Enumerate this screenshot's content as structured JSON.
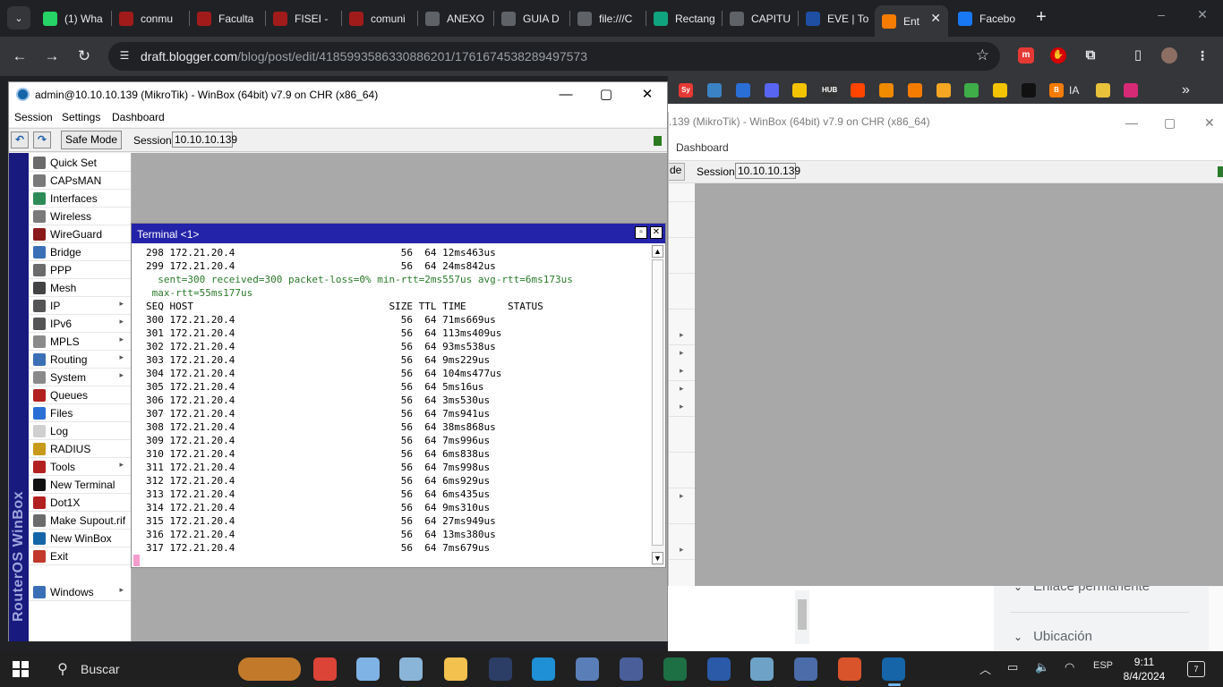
{
  "browser": {
    "tabs": [
      {
        "title": "(1) Wha",
        "icon": "whatsapp-icon",
        "color": "#25d366"
      },
      {
        "title": "conmu",
        "icon": "shield-red-icon",
        "color": "#a11b1b"
      },
      {
        "title": "Faculta",
        "icon": "shield-red-icon",
        "color": "#a11b1b"
      },
      {
        "title": "FISEI -",
        "icon": "shield-red-icon",
        "color": "#a11b1b"
      },
      {
        "title": "comuni",
        "icon": "shield-red-icon",
        "color": "#a11b1b"
      },
      {
        "title": "ANEXO",
        "icon": "globe-icon",
        "color": "#5f6368"
      },
      {
        "title": "GUIA D",
        "icon": "globe-icon",
        "color": "#5f6368"
      },
      {
        "title": "file:///C",
        "icon": "globe-icon",
        "color": "#5f6368"
      },
      {
        "title": "Rectang",
        "icon": "openai-icon",
        "color": "#10a37f"
      },
      {
        "title": "CAPITU",
        "icon": "globe-icon",
        "color": "#5f6368"
      },
      {
        "title": "EVE | To",
        "icon": "eve-icon",
        "color": "#1e4fa3"
      },
      {
        "title": "Ent",
        "icon": "blogger-icon",
        "color": "#f57c00"
      },
      {
        "title": "Facebo",
        "icon": "facebook-icon",
        "color": "#1877f2"
      }
    ],
    "url_host": "draft.blogger.com",
    "url_path": "/blog/post/edit/4185993586330886201/1761674538289497573",
    "bookmarks": [
      {
        "label": "",
        "icon": "sy-icon",
        "color": "#e53935",
        "text": "Sy"
      },
      {
        "label": "",
        "icon": "cloud-icon",
        "color": "#3b82c4",
        "text": ""
      },
      {
        "label": "",
        "icon": "cap-icon",
        "color": "#2a6fd6",
        "text": ""
      },
      {
        "label": "",
        "icon": "discord-icon",
        "color": "#5865f2",
        "text": ""
      },
      {
        "label": "",
        "icon": "image-icon",
        "color": "#f5c400",
        "text": ""
      },
      {
        "label": "",
        "icon": "hub-icon",
        "color": "#333333",
        "text": "HUB"
      },
      {
        "label": "",
        "icon": "reddit-icon",
        "color": "#ff4500",
        "text": ""
      },
      {
        "label": "",
        "icon": "gear-orange-icon",
        "color": "#f08a00",
        "text": ""
      },
      {
        "label": "",
        "icon": "orange-c-icon",
        "color": "#f57c00",
        "text": ""
      },
      {
        "label": "",
        "icon": "infinity-icon",
        "color": "#f5a623",
        "text": ""
      },
      {
        "label": "",
        "icon": "kiwi-icon",
        "color": "#3fae49",
        "text": ""
      },
      {
        "label": "",
        "icon": "chart-icon",
        "color": "#f5c400",
        "text": ""
      },
      {
        "label": "",
        "icon": "notion-icon",
        "color": "#111111",
        "text": ""
      },
      {
        "label": "IA",
        "icon": "blogger-icon",
        "color": "#f57c00",
        "text": "B"
      },
      {
        "label": "",
        "icon": "eye-icon",
        "color": "#e8c23a",
        "text": ""
      },
      {
        "label": "",
        "icon": "instagram-icon",
        "color": "#d62976",
        "text": ""
      }
    ]
  },
  "winbox": {
    "title": "admin@10.10.10.139 (MikroTik) - WinBox (64bit) v7.9 on CHR (x86_64)",
    "menus": [
      "Session",
      "Settings",
      "Dashboard"
    ],
    "safe_mode": "Safe Mode",
    "session_label": "Session:",
    "session_value": "10.10.10.139",
    "vertical_label": "RouterOS WinBox",
    "menu_items": [
      {
        "label": "Quick Set",
        "icon": "quickset-icon",
        "color": "#6b6b6b",
        "sub": false
      },
      {
        "label": "CAPsMAN",
        "icon": "capsman-icon",
        "color": "#7a7a7a",
        "sub": false
      },
      {
        "label": "Interfaces",
        "icon": "interfaces-icon",
        "color": "#2e8b57",
        "sub": false
      },
      {
        "label": "Wireless",
        "icon": "wireless-icon",
        "color": "#7a7a7a",
        "sub": false
      },
      {
        "label": "WireGuard",
        "icon": "wireguard-icon",
        "color": "#8b1a1a",
        "sub": false
      },
      {
        "label": "Bridge",
        "icon": "bridge-icon",
        "color": "#3b6fb6",
        "sub": false
      },
      {
        "label": "PPP",
        "icon": "ppp-icon",
        "color": "#6b6b6b",
        "sub": false
      },
      {
        "label": "Mesh",
        "icon": "mesh-icon",
        "color": "#444444",
        "sub": false
      },
      {
        "label": "IP",
        "icon": "ip-icon",
        "color": "#555555",
        "sub": true
      },
      {
        "label": "IPv6",
        "icon": "ipv6-icon",
        "color": "#555555",
        "sub": true
      },
      {
        "label": "MPLS",
        "icon": "mpls-icon",
        "color": "#8a8a8a",
        "sub": true
      },
      {
        "label": "Routing",
        "icon": "routing-icon",
        "color": "#3b6fb6",
        "sub": true
      },
      {
        "label": "System",
        "icon": "system-icon",
        "color": "#8a8a8a",
        "sub": true
      },
      {
        "label": "Queues",
        "icon": "queues-icon",
        "color": "#b32020",
        "sub": false
      },
      {
        "label": "Files",
        "icon": "files-icon",
        "color": "#2a6fd6",
        "sub": false
      },
      {
        "label": "Log",
        "icon": "log-icon",
        "color": "#cfcfcf",
        "sub": false
      },
      {
        "label": "RADIUS",
        "icon": "radius-icon",
        "color": "#c89a1a",
        "sub": false
      },
      {
        "label": "Tools",
        "icon": "tools-icon",
        "color": "#b32020",
        "sub": true
      },
      {
        "label": "New Terminal",
        "icon": "terminal-icon",
        "color": "#111111",
        "sub": false
      },
      {
        "label": "Dot1X",
        "icon": "dot1x-icon",
        "color": "#b32020",
        "sub": false
      },
      {
        "label": "Make Supout.rif",
        "icon": "supout-icon",
        "color": "#6b6b6b",
        "sub": false
      },
      {
        "label": "New WinBox",
        "icon": "winbox-icon",
        "color": "#1565a8",
        "sub": false
      },
      {
        "label": "Exit",
        "icon": "exit-icon",
        "color": "#c0392b",
        "sub": false
      },
      {
        "label": "Windows",
        "icon": "windows-icon",
        "color": "#3b6fb6",
        "sub": true
      }
    ]
  },
  "winbox_back": {
    "title": ".139 (MikroTik) - WinBox (64bit) v7.9 on CHR (x86_64)",
    "menu": "Dashboard",
    "safe_mode": "de",
    "session_label": "Session:",
    "session_value": "10.10.10.139"
  },
  "terminal": {
    "title": "Terminal <1>",
    "lines": [
      {
        "text": "298 172.21.20.4                            56  64 12ms463us",
        "kind": "row"
      },
      {
        "text": "299 172.21.20.4                            56  64 24ms842us",
        "kind": "row"
      },
      {
        "text": "  sent=300 received=300 packet-loss=0% min-rtt=2ms557us avg-rtt=6ms173us",
        "kind": "stat"
      },
      {
        "text": " max-rtt=55ms177us",
        "kind": "stat"
      },
      {
        "text": "SEQ HOST                                 SIZE TTL TIME       STATUS",
        "kind": "header"
      },
      {
        "text": "300 172.21.20.4                            56  64 71ms669us",
        "kind": "row"
      },
      {
        "text": "301 172.21.20.4                            56  64 113ms409us",
        "kind": "row"
      },
      {
        "text": "302 172.21.20.4                            56  64 93ms538us",
        "kind": "row"
      },
      {
        "text": "303 172.21.20.4                            56  64 9ms229us",
        "kind": "row"
      },
      {
        "text": "304 172.21.20.4                            56  64 104ms477us",
        "kind": "row"
      },
      {
        "text": "305 172.21.20.4                            56  64 5ms16us",
        "kind": "row"
      },
      {
        "text": "306 172.21.20.4                            56  64 3ms530us",
        "kind": "row"
      },
      {
        "text": "307 172.21.20.4                            56  64 7ms941us",
        "kind": "row"
      },
      {
        "text": "308 172.21.20.4                            56  64 38ms868us",
        "kind": "row"
      },
      {
        "text": "309 172.21.20.4                            56  64 7ms996us",
        "kind": "row"
      },
      {
        "text": "310 172.21.20.4                            56  64 6ms838us",
        "kind": "row"
      },
      {
        "text": "311 172.21.20.4                            56  64 7ms998us",
        "kind": "row"
      },
      {
        "text": "312 172.21.20.4                            56  64 6ms929us",
        "kind": "row"
      },
      {
        "text": "313 172.21.20.4                            56  64 6ms435us",
        "kind": "row"
      },
      {
        "text": "314 172.21.20.4                            56  64 9ms310us",
        "kind": "row"
      },
      {
        "text": "315 172.21.20.4                            56  64 27ms949us",
        "kind": "row"
      },
      {
        "text": "316 172.21.20.4                            56  64 13ms380us",
        "kind": "row"
      },
      {
        "text": "317 172.21.20.4                            56  64 7ms679us",
        "kind": "row"
      }
    ]
  },
  "blogger_panel": {
    "link_item": "Enlace permanente",
    "location_item": "Ubicación"
  },
  "taskbar": {
    "search_placeholder": "Buscar",
    "language": "ESP",
    "time": "9:11",
    "date": "8/4/2024",
    "notifications": "7",
    "apps": [
      {
        "icon": "hedgehog-icon",
        "color": "#c27a2a"
      },
      {
        "icon": "chrome-icon",
        "color": "#db4437"
      },
      {
        "icon": "paint-icon",
        "color": "#7fb2e5"
      },
      {
        "icon": "monitor-icon",
        "color": "#8ab4d8"
      },
      {
        "icon": "folder-icon",
        "color": "#f2c14e"
      },
      {
        "icon": "dev-icon",
        "color": "#2c3e66"
      },
      {
        "icon": "box-icon",
        "color": "#1f8fd6"
      },
      {
        "icon": "network-icon",
        "color": "#5a7fb8"
      },
      {
        "icon": "pc-icon",
        "color": "#4a5f9a"
      },
      {
        "icon": "excel-icon",
        "color": "#1d7044"
      },
      {
        "icon": "word-icon",
        "color": "#2b5aa8"
      },
      {
        "icon": "notes-icon",
        "color": "#6ea3c7"
      },
      {
        "icon": "remote-icon",
        "color": "#4b6ca8"
      },
      {
        "icon": "matlab-icon",
        "color": "#d9542b"
      },
      {
        "icon": "winbox-taskbar-icon",
        "color": "#1565a8"
      }
    ]
  }
}
